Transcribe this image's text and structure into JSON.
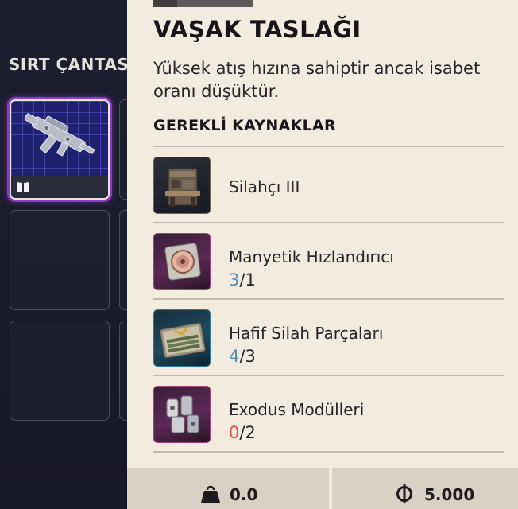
{
  "inventory": {
    "title": "SIRT ÇANTASI"
  },
  "item": {
    "title": "VAŞAK TASLAĞI",
    "description": "Yüksek atış hızına sahiptir ancak isabet oranı düşüktür.",
    "requirements_title": "GEREKLİ KAYNAKLAR",
    "requirements": [
      {
        "name": "Silahçı III",
        "icon": "workbench-icon"
      },
      {
        "name": "Manyetik Hızlandırıcı",
        "have": "3",
        "need": "/1",
        "status": "ok",
        "icon": "magnetic-accelerator-icon"
      },
      {
        "name": "Hafif Silah Parçaları",
        "have": "4",
        "need": "/3",
        "status": "ok",
        "icon": "weapon-parts-case-icon"
      },
      {
        "name": "Exodus Modülleri",
        "have": "0",
        "need": "/2",
        "status": "bad",
        "icon": "exodus-modules-icon"
      }
    ]
  },
  "stats": {
    "weight": "0.0",
    "price": "5.000",
    "weight_icon": "weight-icon",
    "price_icon": "currency-icon"
  },
  "colors": {
    "panel_bg": "#f4ebdf",
    "have_ok": "#4f8fb8",
    "have_bad": "#e0564a",
    "selected_glow": "#8c39c9"
  }
}
